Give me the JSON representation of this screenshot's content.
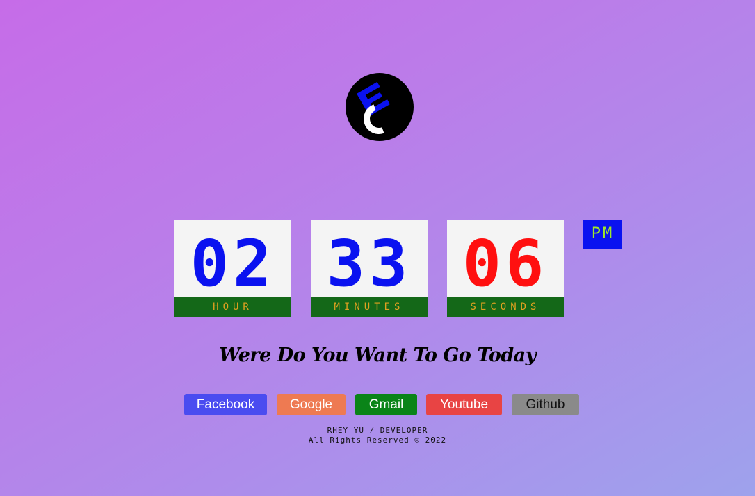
{
  "logo": {
    "letters": "EC"
  },
  "clock": {
    "hour": {
      "value": "02",
      "label": "HOUR",
      "color": "#0a12f0"
    },
    "minutes": {
      "value": "33",
      "label": "MINUTES",
      "color": "#0a12f0"
    },
    "seconds": {
      "value": "06",
      "label": "SECONDS",
      "color": "#ff1010"
    },
    "period": "PM"
  },
  "tagline": "Were Do You Want To Go Today",
  "links": [
    {
      "label": "Facebook",
      "bg": "#4a4cf0",
      "fg": "#ffffff"
    },
    {
      "label": "Google",
      "bg": "#ee7a52",
      "fg": "#ffffff"
    },
    {
      "label": "Gmail",
      "bg": "#0a8418",
      "fg": "#ffffff"
    },
    {
      "label": "Youtube",
      "bg": "#e84444",
      "fg": "#ffffff"
    },
    {
      "label": "Github",
      "bg": "#8a8a8a",
      "fg": "#111111"
    }
  ],
  "footer": {
    "line1": "RHEY YU / DEVELOPER",
    "line2": "All Rights Reserved © 2022"
  }
}
